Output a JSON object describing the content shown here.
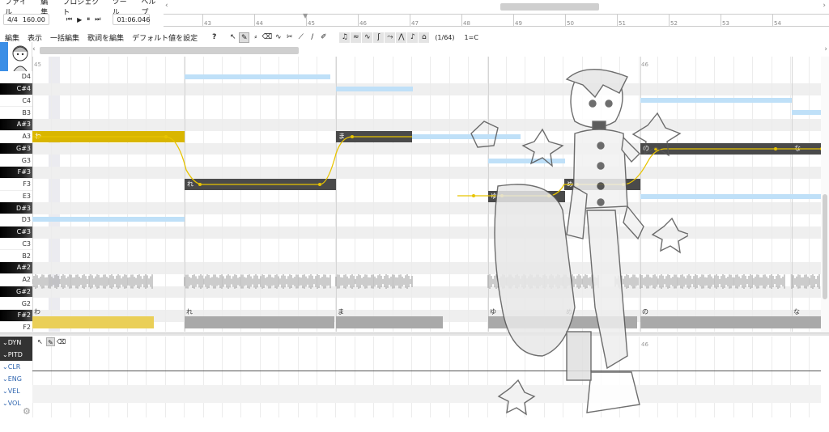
{
  "menu": [
    "ファイル",
    "編集",
    "プロジェクト",
    "ツール",
    "ヘルプ"
  ],
  "transport": {
    "time_signature": "4/4",
    "tempo": "160.00",
    "position": "01:06.046"
  },
  "ruler": {
    "bars": [
      "43",
      "44",
      "45",
      "46",
      "47",
      "48",
      "49",
      "50",
      "51",
      "52",
      "53",
      "54"
    ]
  },
  "toolbar": {
    "menus": [
      "編集",
      "表示",
      "一括編集",
      "歌詞を編集",
      "デフォルト値を設定",
      "?"
    ],
    "snap": "(1/64)",
    "key": "1=C"
  },
  "grid_labels": {
    "left_bar": "45",
    "right_bar": "46"
  },
  "keys": [
    "D4",
    "C#4",
    "C4",
    "B3",
    "A#3",
    "A3",
    "G#3",
    "G3",
    "F#3",
    "F3",
    "E3",
    "D#3",
    "D3",
    "C#3",
    "C3",
    "B2",
    "A#2",
    "A2",
    "G#2",
    "G2",
    "F#2",
    "F2"
  ],
  "notes": [
    {
      "lyric": "わ",
      "pitch": "A3"
    },
    {
      "lyric": "れ",
      "pitch": "F3"
    },
    {
      "lyric": "ま",
      "pitch": "A3"
    },
    {
      "lyric": "ゆ",
      "pitch": "E3"
    },
    {
      "lyric": "め",
      "pitch": "F3"
    },
    {
      "lyric": "の",
      "pitch": "G#3"
    },
    {
      "lyric": "な",
      "pitch": "G#3"
    }
  ],
  "lyric_lane": [
    "わ",
    "れ",
    "ま",
    "ゆ",
    "め",
    "の",
    "な"
  ],
  "params": [
    "DYN",
    "PITD",
    "CLR",
    "ENG",
    "VEL",
    "VOL"
  ],
  "colors": {
    "accent": "#3b8ee6",
    "note": "#4a4a4a",
    "note_selected": "#d9b600",
    "pitch_line": "#e8c400",
    "reference": "#bfe0f8"
  }
}
